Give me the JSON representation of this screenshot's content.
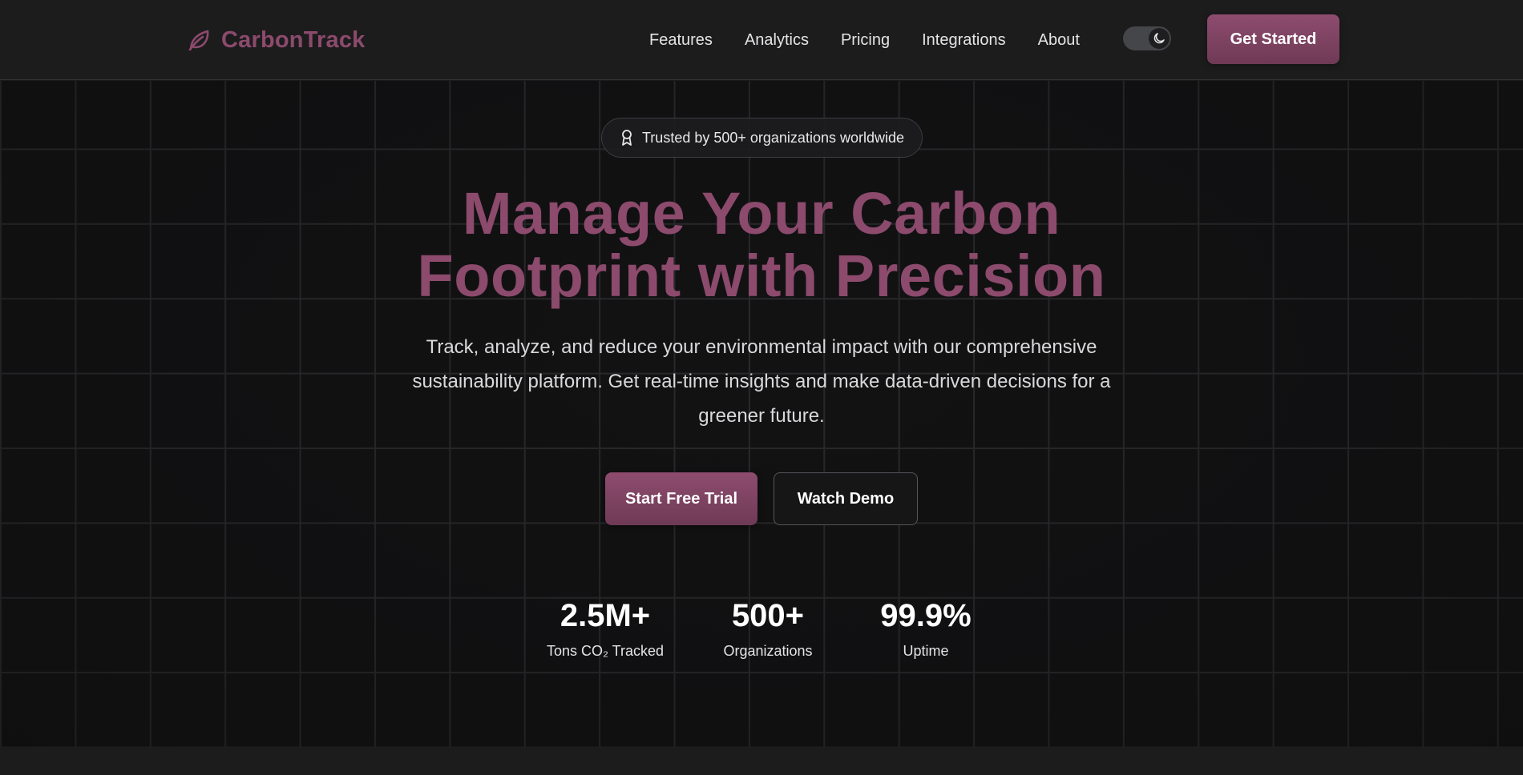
{
  "header": {
    "brand": "CarbonTrack",
    "brand_icon": "leaf-icon",
    "nav": [
      "Features",
      "Analytics",
      "Pricing",
      "Integrations",
      "About"
    ],
    "theme_toggle_icon": "moon-icon",
    "theme_mode": "dark",
    "cta_label": "Get Started"
  },
  "hero": {
    "badge_icon": "award-icon",
    "badge_text": "Trusted by 500+ organizations worldwide",
    "title_line1": "Manage Your Carbon",
    "title_line2": "Footprint with Precision",
    "subtitle": "Track, analyze, and reduce your environmental impact with our comprehensive sustainability platform. Get real-time insights and make data-driven decisions for a greener future.",
    "primary_cta": "Start Free Trial",
    "secondary_cta": "Watch Demo"
  },
  "stats": [
    {
      "value": "2.5M+",
      "label": "Tons CO₂ Tracked"
    },
    {
      "value": "500+",
      "label": "Organizations"
    },
    {
      "value": "99.9%",
      "label": "Uptime"
    }
  ],
  "colors": {
    "accent": "#8c4a6c",
    "background": "#121213",
    "header_bg": "#1c1c1d",
    "grid_line": "#2a2a2d"
  }
}
